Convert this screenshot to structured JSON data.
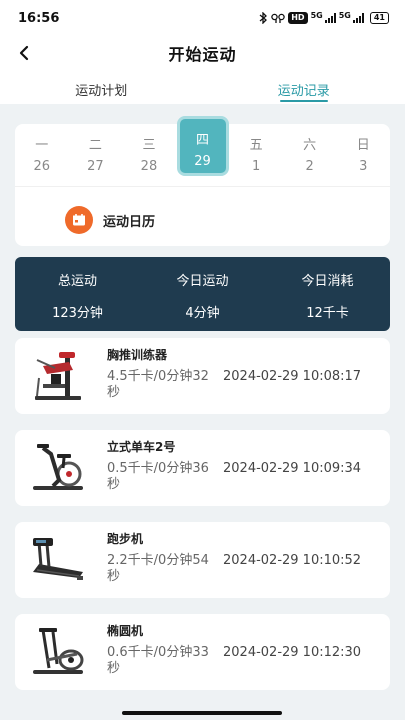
{
  "status": {
    "time": "16:56",
    "hd": "HD",
    "net1": "5G",
    "net2": "5G",
    "battery": "41"
  },
  "nav": {
    "title": "开始运动"
  },
  "tabs": [
    {
      "label": "运动计划"
    },
    {
      "label": "运动记录"
    }
  ],
  "week": [
    {
      "weekday": "一",
      "date": "26"
    },
    {
      "weekday": "二",
      "date": "27"
    },
    {
      "weekday": "三",
      "date": "28"
    },
    {
      "weekday": "四",
      "date": "29"
    },
    {
      "weekday": "五",
      "date": "1"
    },
    {
      "weekday": "六",
      "date": "2"
    },
    {
      "weekday": "日",
      "date": "3"
    }
  ],
  "calendar": {
    "label": "运动日历"
  },
  "summary": [
    {
      "label": "总运动",
      "value": "123分钟"
    },
    {
      "label": "今日运动",
      "value": "4分钟"
    },
    {
      "label": "今日消耗",
      "value": "12千卡"
    }
  ],
  "records": [
    {
      "name": "胸推训练器",
      "stats": "4.5千卡/0分钟32秒",
      "time": "2024-02-29 10:08:17"
    },
    {
      "name": "立式单车2号",
      "stats": "0.5千卡/0分钟36秒",
      "time": "2024-02-29 10:09:34"
    },
    {
      "name": "跑步机",
      "stats": "2.2千卡/0分钟54秒",
      "time": "2024-02-29 10:10:52"
    },
    {
      "name": "椭圆机",
      "stats": "0.6千卡/0分钟33秒",
      "time": "2024-02-29 10:12:30"
    }
  ],
  "colors": {
    "accent": "#2a9aa6",
    "summary_bg": "#1f3b4f",
    "calendar_icon": "#ef6a2a",
    "selected_day": "#52b5be"
  }
}
